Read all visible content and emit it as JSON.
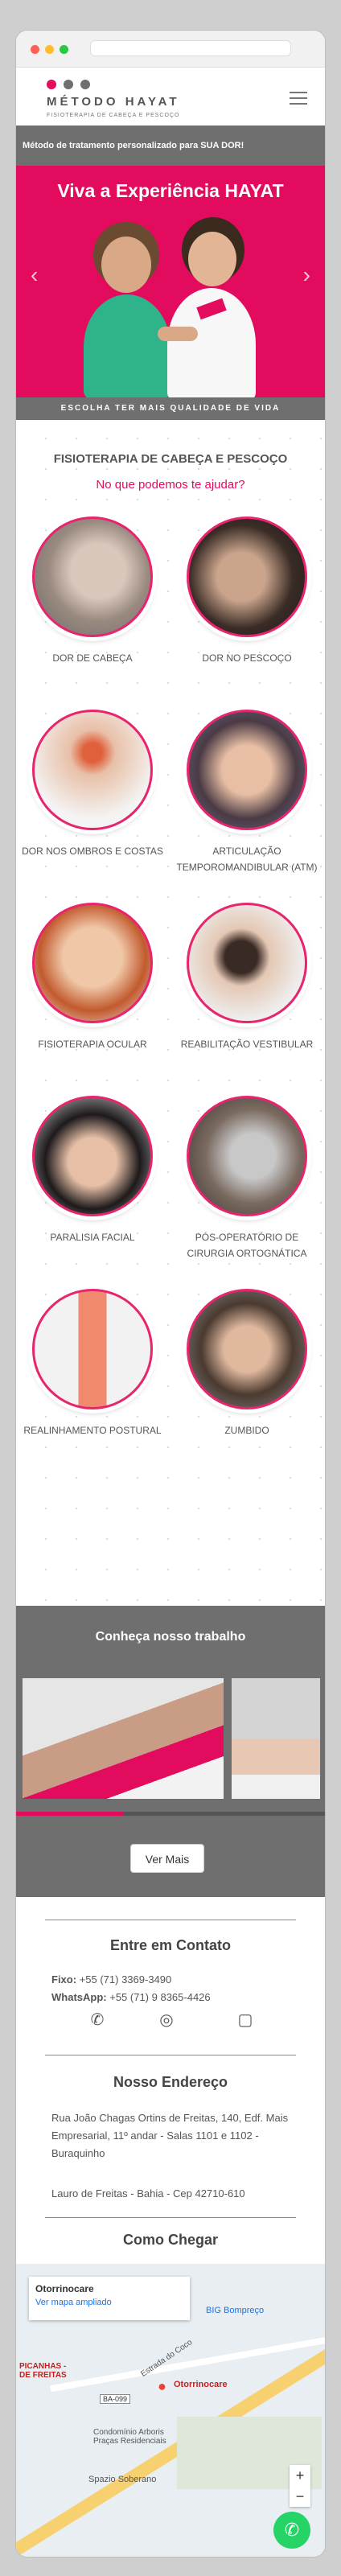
{
  "brand": {
    "title": "MÉTODO HAYAT",
    "subtitle": "FISIOTERAPIA DE CABEÇA E PESCOÇO",
    "dot_colors": [
      "#e30b5d",
      "#6f6f6f",
      "#6f6f6f"
    ]
  },
  "marquee": "Método de tratamento personalizado para SUA DOR!",
  "hero": {
    "title": "Viva a Experiência HAYAT",
    "footer": "ESCOLHA TER MAIS QUALIDADE DE VIDA",
    "prev": "‹",
    "next": "›"
  },
  "services": {
    "title": "FISIOTERAPIA DE CABEÇA E PESCOÇO",
    "subtitle": "No que podemos te ajudar?",
    "items": [
      {
        "label": "DOR DE CABEÇA"
      },
      {
        "label": "DOR NO PESCOÇO"
      },
      {
        "label": "DOR NOS OMBROS E COSTAS"
      },
      {
        "label": "ARTICULAÇÃO TEMPOROMANDIBULAR (ATM)"
      },
      {
        "label": "FISIOTERAPIA OCULAR"
      },
      {
        "label": "REABILITAÇÃO VESTIBULAR"
      },
      {
        "label": "PARALISIA FACIAL"
      },
      {
        "label": "PÓS-OPERATÓRIO DE CIRURGIA ORTOGNÁTICA"
      },
      {
        "label": "REALINHAMENTO POSTURAL"
      },
      {
        "label": "ZUMBIDO"
      }
    ]
  },
  "work": {
    "title": "Conheça nosso trabalho",
    "button": "Ver Mais",
    "progress": 0.35
  },
  "contact": {
    "title": "Entre em Contato",
    "phone_label": "Fixo:",
    "phone": "+55 (71) 3369-3490",
    "whatsapp_label": "WhatsApp:",
    "whatsapp": "+55 (71) 9 8365-4426",
    "icons": [
      "phone-icon",
      "whatsapp-icon",
      "instagram-icon"
    ]
  },
  "address": {
    "title": "Nosso Endereço",
    "line1": "Rua João Chagas Ortins de Freitas, 140, Edf. Mais Empresarial, 11º andar - Salas 1101 e 1102 - Buraquinho",
    "line2": "Lauro de Freitas - Bahia - Cep 42710-610"
  },
  "directions": {
    "title": "Como Chegar",
    "place": "Otorrinocare",
    "map_link": "Ver mapa ampliado",
    "labels": [
      "BIG Bompreço",
      "Estrada do Coco",
      "Otorrinocare",
      "Condomínio Arboris Praças Residenciais",
      "Spazio Soberano",
      "PICANHAS - DE FREITAS",
      "BA-099"
    ]
  }
}
